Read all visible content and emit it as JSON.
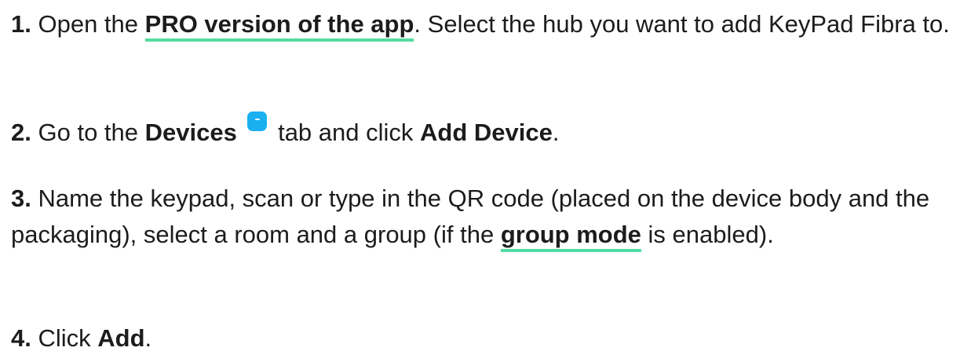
{
  "steps": [
    {
      "number": "1.",
      "text_before": "Open the ",
      "link": "PRO version of the app",
      "text_after": ". Select the hub you want to add KeyPad Fibra to."
    },
    {
      "number": "2.",
      "text_before": "Go to the ",
      "bold_1": "Devices",
      "icon": "devices-tab-icon",
      "text_middle": " tab and click ",
      "bold_2": "Add Device",
      "text_after": "."
    },
    {
      "number": "3.",
      "text_before": "Name the keypad, scan or type in the QR code (placed on the device body and the packaging), select a room and a group (if the ",
      "link": "group mode",
      "text_after": " is enabled)."
    },
    {
      "number": "4.",
      "text_before": "Click ",
      "bold": "Add",
      "text_after": "."
    }
  ],
  "colors": {
    "text": "#1c1c1c",
    "link_underline": "#52dba0",
    "icon_fill": "#1ab0f0"
  }
}
